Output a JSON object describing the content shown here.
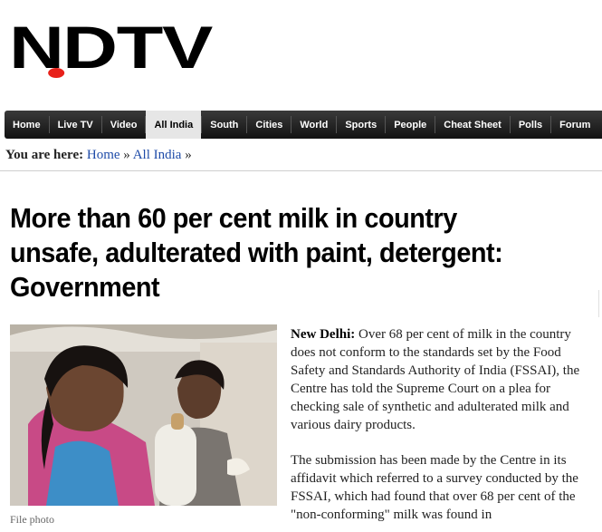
{
  "logo": {
    "text_left": "N",
    "text_right": "DTV"
  },
  "nav": {
    "items": [
      {
        "label": "Home",
        "active": false
      },
      {
        "label": "Live TV",
        "active": false
      },
      {
        "label": "Video",
        "active": false
      },
      {
        "label": "All India",
        "active": true
      },
      {
        "label": "South",
        "active": false
      },
      {
        "label": "Cities",
        "active": false
      },
      {
        "label": "World",
        "active": false
      },
      {
        "label": "Sports",
        "active": false
      },
      {
        "label": "People",
        "active": false
      },
      {
        "label": "Cheat Sheet",
        "active": false
      },
      {
        "label": "Polls",
        "active": false
      },
      {
        "label": "Forum",
        "active": false
      }
    ]
  },
  "breadcrumb": {
    "label": "You are here:",
    "links": [
      "Home",
      "All India"
    ],
    "separator": "»"
  },
  "article": {
    "headline": "More than 60 per cent milk in country unsafe, adulterated with paint, detergent: Government",
    "photo_caption": "File photo",
    "dateline": "New Delhi:",
    "para1": "Over 68 per cent of milk in the country does not conform to the standards set by the Food Safety and Standards Authority of India (FSSAI), the Centre has told the Supreme Court on a plea for checking sale of synthetic and adulterated milk and various dairy products.",
    "para2": "The submission has been made by the Centre in its affidavit which referred to a survey conducted by the FSSAI, which had found that over 68 per cent of the \"non-conforming\" milk was found in"
  },
  "colors": {
    "brand_red": "#e8211a",
    "nav_bg": "#1f1f1f",
    "link": "#1e4ba8"
  }
}
